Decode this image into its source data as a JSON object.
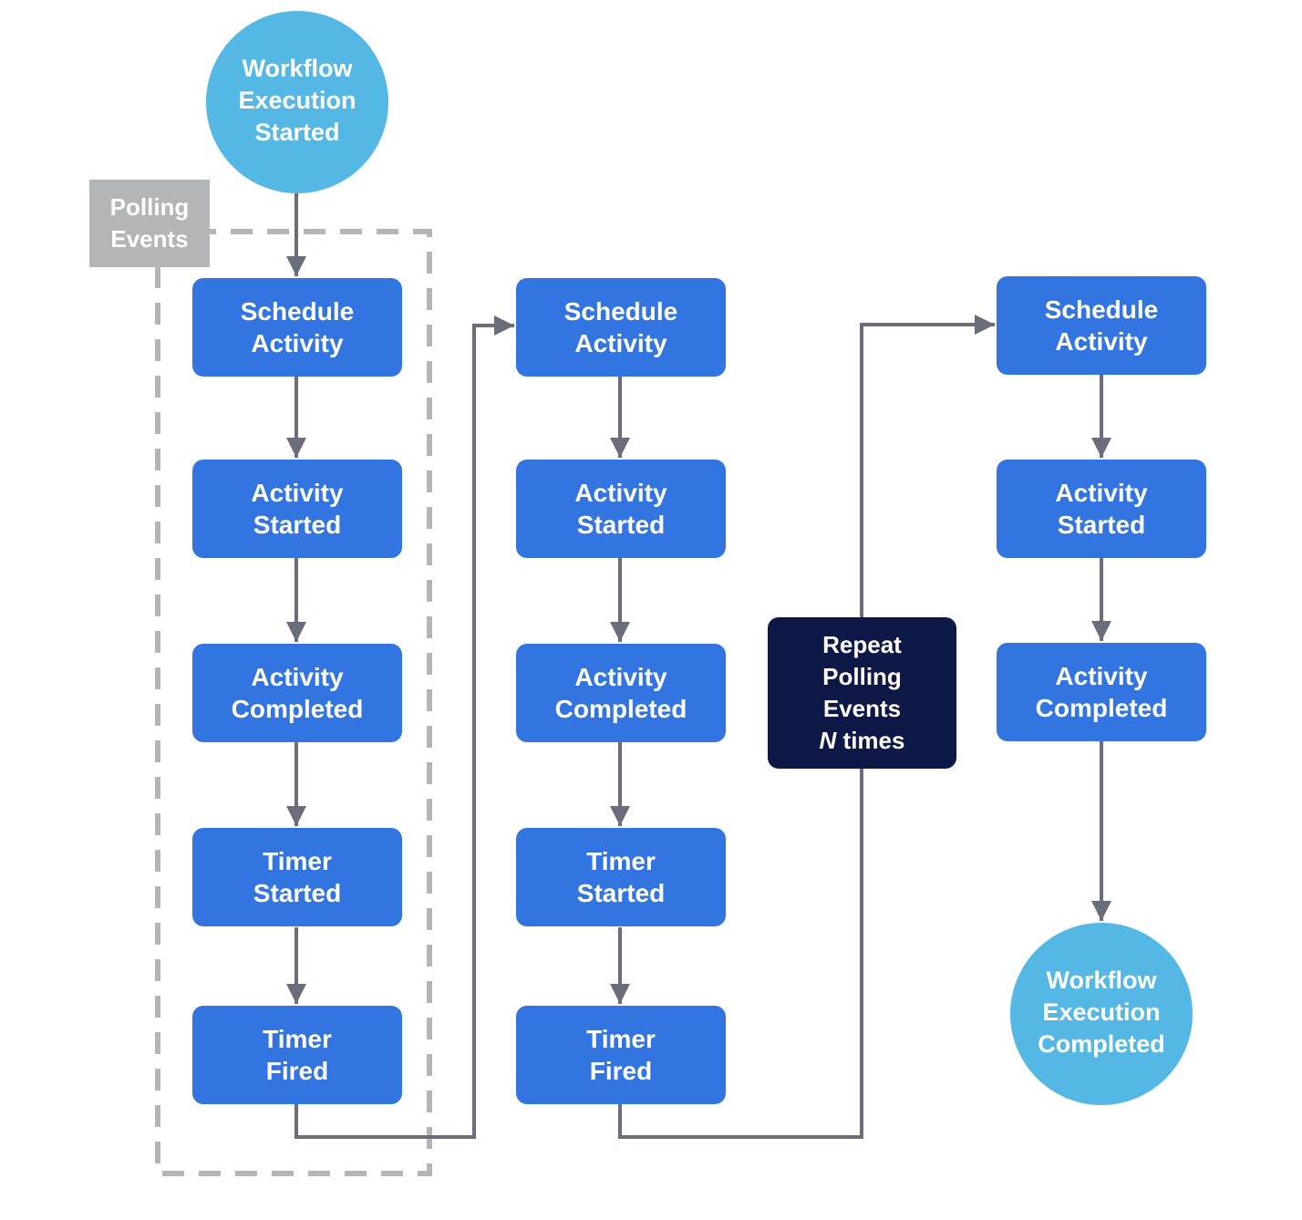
{
  "diagram": {
    "start": {
      "lines": [
        "Workflow",
        "Execution",
        "Started"
      ]
    },
    "end": {
      "lines": [
        "Workflow",
        "Execution",
        "Completed"
      ]
    },
    "polling_group_label": {
      "lines": [
        "Polling",
        "Events"
      ]
    },
    "columns": [
      {
        "nodes": [
          {
            "lines": [
              "Schedule",
              "Activity"
            ]
          },
          {
            "lines": [
              "Activity",
              "Started"
            ]
          },
          {
            "lines": [
              "Activity",
              "Completed"
            ]
          },
          {
            "lines": [
              "Timer",
              "Started"
            ]
          },
          {
            "lines": [
              "Timer",
              "Fired"
            ]
          }
        ]
      },
      {
        "nodes": [
          {
            "lines": [
              "Schedule",
              "Activity"
            ]
          },
          {
            "lines": [
              "Activity",
              "Started"
            ]
          },
          {
            "lines": [
              "Activity",
              "Completed"
            ]
          },
          {
            "lines": [
              "Timer",
              "Started"
            ]
          },
          {
            "lines": [
              "Timer",
              "Fired"
            ]
          }
        ]
      },
      {
        "nodes": [
          {
            "lines": [
              "Schedule",
              "Activity"
            ]
          },
          {
            "lines": [
              "Activity",
              "Started"
            ]
          },
          {
            "lines": [
              "Activity",
              "Completed"
            ]
          }
        ]
      }
    ],
    "repeat": {
      "lines": [
        "Repeat",
        "Polling",
        "Events"
      ],
      "n_symbol": "N",
      "n_suffix": " times"
    },
    "colors": {
      "event_box": "#3375e0",
      "terminal_circle": "#55b8e4",
      "repeat_box": "#0d1847",
      "connector": "#6b6d7b",
      "polling_group": "#b3b6b7"
    }
  }
}
